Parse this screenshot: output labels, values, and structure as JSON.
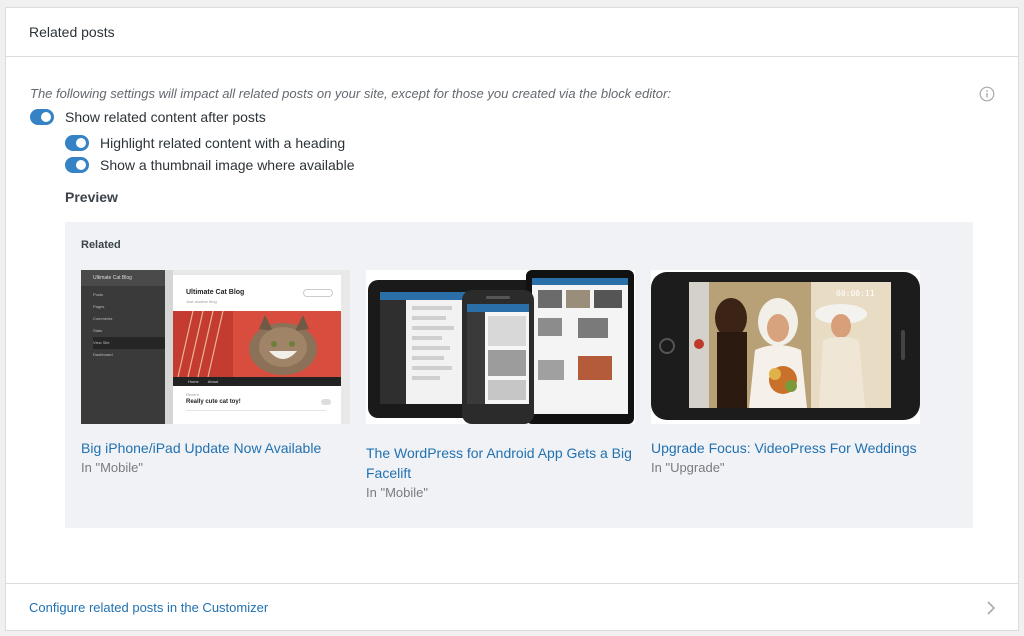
{
  "header": {
    "title": "Related posts"
  },
  "notice": "The following settings will impact all related posts on your site, except for those you created via the block editor:",
  "toggles": [
    {
      "label": "Show related content after posts",
      "enabled": true
    },
    {
      "label": "Highlight related content with a heading",
      "enabled": true
    },
    {
      "label": "Show a thumbnail image where available",
      "enabled": true
    }
  ],
  "preview": {
    "label": "Preview",
    "heading": "Related",
    "posts": [
      {
        "title": "Big iPhone/iPad Update Now Available",
        "category": "In \"Mobile\"",
        "thumb": {
          "blog_name": "Ultimate Cat Blog",
          "tagline": "Just another blog",
          "sidebar_title": "Ultimate Cat Blog",
          "sidebar_items": [
            "Posts",
            "Pages",
            "Comments",
            "Stats",
            "View Site",
            "Dashboard"
          ],
          "nav_items": [
            "Home",
            "About"
          ],
          "post_date": "Recent",
          "post_title": "Really cute cat toy!"
        }
      },
      {
        "title": "The WordPress for Android App Gets a Big Facelift",
        "category": "In \"Mobile\""
      },
      {
        "title": "Upgrade Focus: VideoPress For Weddings",
        "category": "In \"Upgrade\"",
        "thumb": {
          "timestamp": "00:00:11"
        }
      }
    ]
  },
  "footer": {
    "link": "Configure related posts in the Customizer"
  },
  "colors": {
    "accent": "#3582c4",
    "link": "#2271b1"
  }
}
